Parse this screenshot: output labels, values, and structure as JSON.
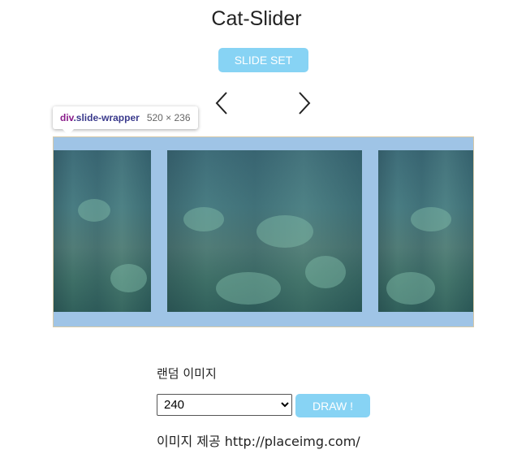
{
  "header": {
    "title": "Cat-Slider"
  },
  "controls": {
    "slide_set_label": "SLIDE SET",
    "prev_icon": "chevron-left-icon",
    "next_icon": "chevron-right-icon"
  },
  "devtools_tooltip": {
    "tag": "div",
    "class_name": ".slide-wrapper",
    "size": "520 × 236"
  },
  "slider": {
    "slides": [
      "forest-image",
      "forest-image",
      "forest-image"
    ],
    "background_color": "#9fc4e6"
  },
  "random_image": {
    "label": "랜덤 이미지",
    "selected_size": "240",
    "draw_label": "DRAW !",
    "provider_prefix": "이미지 제공",
    "provider_url": "http://placeimg.com/"
  },
  "colors": {
    "accent": "#87d3f4"
  }
}
